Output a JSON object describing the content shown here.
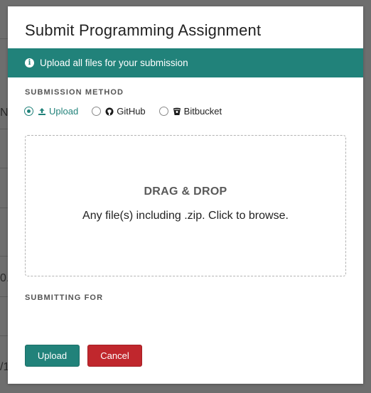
{
  "modal": {
    "title": "Submit Programming Assignment",
    "info_banner": {
      "icon": "info-circle-icon",
      "text": "Upload all files for your submission"
    },
    "submission_method": {
      "label": "SUBMISSION METHOD",
      "selected": "Upload",
      "options": [
        {
          "label": "Upload",
          "icon": "upload-icon",
          "selected": true
        },
        {
          "label": "GitHub",
          "icon": "github-icon",
          "selected": false
        },
        {
          "label": "Bitbucket",
          "icon": "bitbucket-icon",
          "selected": false
        }
      ]
    },
    "dropzone": {
      "title": "DRAG & DROP",
      "subtitle": "Any file(s) including .zip. Click to browse."
    },
    "submitting_for": {
      "label": "SUBMITTING FOR"
    },
    "buttons": {
      "upload": "Upload",
      "cancel": "Cancel"
    }
  },
  "background_fragments": [
    "N",
    "0.",
    "/1"
  ],
  "colors": {
    "accent": "#21827a",
    "danger": "#c0272d",
    "overlay": "#6e6e6e"
  }
}
